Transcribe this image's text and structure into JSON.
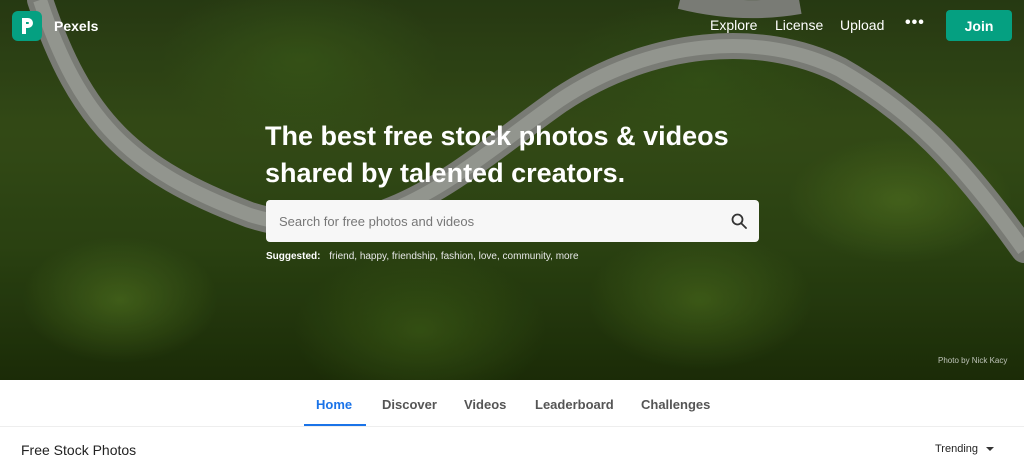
{
  "brand": {
    "name": "Pexels",
    "logo_icon": "pexels-logo-icon",
    "color": "#05a081"
  },
  "nav": {
    "links": [
      {
        "label": "Explore"
      },
      {
        "label": "License"
      },
      {
        "label": "Upload"
      }
    ],
    "more_label": "•••",
    "join_label": "Join"
  },
  "hero": {
    "headline_line1": "The best free stock photos & videos",
    "headline_line2": "shared by talented creators.",
    "credit": "Photo by Nick Kacy"
  },
  "search": {
    "placeholder": "Search for free photos and videos",
    "value": "",
    "icon": "search-icon"
  },
  "suggested": {
    "label": "Suggested:",
    "items": [
      "friend",
      "happy",
      "friendship",
      "fashion",
      "love",
      "community",
      "more"
    ]
  },
  "tabs": [
    {
      "label": "Home",
      "active": true
    },
    {
      "label": "Discover",
      "active": false
    },
    {
      "label": "Videos",
      "active": false
    },
    {
      "label": "Leaderboard",
      "active": false
    },
    {
      "label": "Challenges",
      "active": false
    }
  ],
  "section": {
    "title": "Free Stock Photos",
    "sort_label": "Trending"
  },
  "colors": {
    "accent": "#05a081",
    "active_tab": "#1a73e8"
  }
}
